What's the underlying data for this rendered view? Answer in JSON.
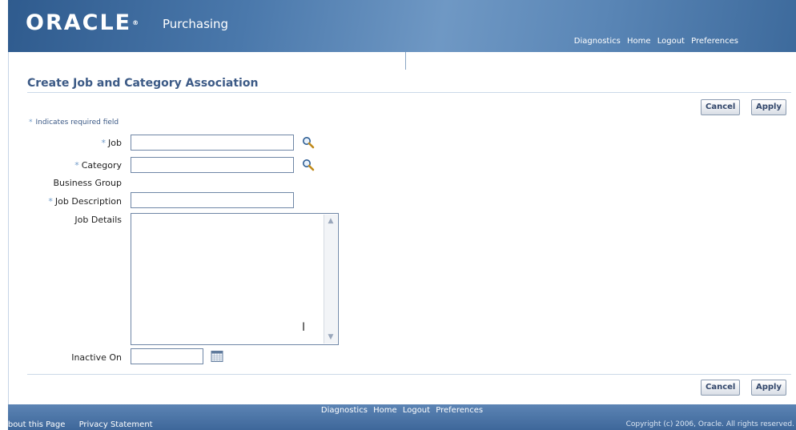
{
  "header": {
    "logo": "ORACLE",
    "logo_mark": "®",
    "app_name": "Purchasing",
    "links": [
      "Diagnostics",
      "Home",
      "Logout",
      "Preferences"
    ]
  },
  "page": {
    "title": "Create Job and Category Association",
    "required_note": "Indicates required field",
    "required_star": "*"
  },
  "buttons": {
    "cancel": "Cancel",
    "apply": "Apply"
  },
  "form": {
    "job": {
      "label": "Job",
      "value": ""
    },
    "category": {
      "label": "Category",
      "value": ""
    },
    "business_group": {
      "label": "Business Group",
      "value": ""
    },
    "job_description": {
      "label": "Job Description",
      "value": ""
    },
    "job_details": {
      "label": "Job Details",
      "value": ""
    },
    "inactive_on": {
      "label": "Inactive On",
      "value": ""
    }
  },
  "footer": {
    "links": [
      "Diagnostics",
      "Home",
      "Logout",
      "Preferences"
    ],
    "about": "About this Page",
    "privacy": "Privacy Statement",
    "copyright": "Copyright (c) 2006, Oracle. All rights reserved."
  },
  "icons": {
    "search": "magnifier-icon",
    "calendar": "calendar-icon"
  },
  "colors": {
    "header_dark": "#2f5b8e",
    "title": "#3c5a86",
    "required_star": "#6f9ac9"
  }
}
